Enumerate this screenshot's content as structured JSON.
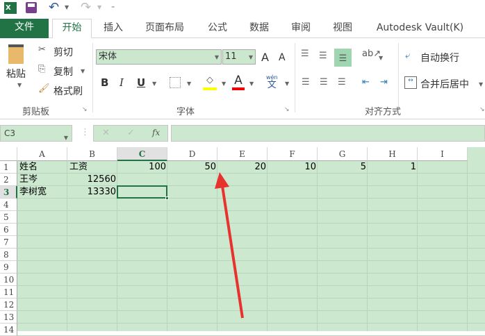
{
  "qat": {
    "undo": "undo",
    "redo": "redo"
  },
  "tabs": [
    "文件",
    "开始",
    "插入",
    "页面布局",
    "公式",
    "数据",
    "审阅",
    "视图",
    "Autodesk Vault(K)"
  ],
  "clipboard": {
    "paste": "粘贴",
    "cut": "剪切",
    "copy": "复制",
    "format_painter": "格式刷",
    "label": "剪贴板"
  },
  "font": {
    "name": "宋体",
    "size": "11",
    "bold": "B",
    "italic": "I",
    "underline": "U",
    "grow": "A",
    "shrink": "A",
    "phonetic_top": "wén",
    "phonetic": "文",
    "font_color": "A",
    "label": "字体"
  },
  "alignment": {
    "wrap": "自动换行",
    "merge": "合并后居中",
    "label": "对齐方式"
  },
  "formula_bar": {
    "name_box": "C3",
    "fx": "fx",
    "cancel": "✕",
    "enter": "✓",
    "value": ""
  },
  "columns": [
    "A",
    "B",
    "C",
    "D",
    "E",
    "F",
    "G",
    "H",
    "I"
  ],
  "rows": [
    "1",
    "2",
    "3",
    "4",
    "5",
    "6",
    "7",
    "8",
    "9",
    "10",
    "11",
    "12",
    "13",
    "14"
  ],
  "cells": {
    "A1": "姓名",
    "B1": "工资",
    "C1": "100",
    "D1": "50",
    "E1": "20",
    "F1": "10",
    "G1": "5",
    "H1": "1",
    "A2": "王岑",
    "B2": "12560",
    "A3": "李树宽",
    "B3": "13330"
  },
  "colors": {
    "accent": "#217346",
    "cell_bg": "#cce8cf",
    "arrow": "#e8322d"
  }
}
